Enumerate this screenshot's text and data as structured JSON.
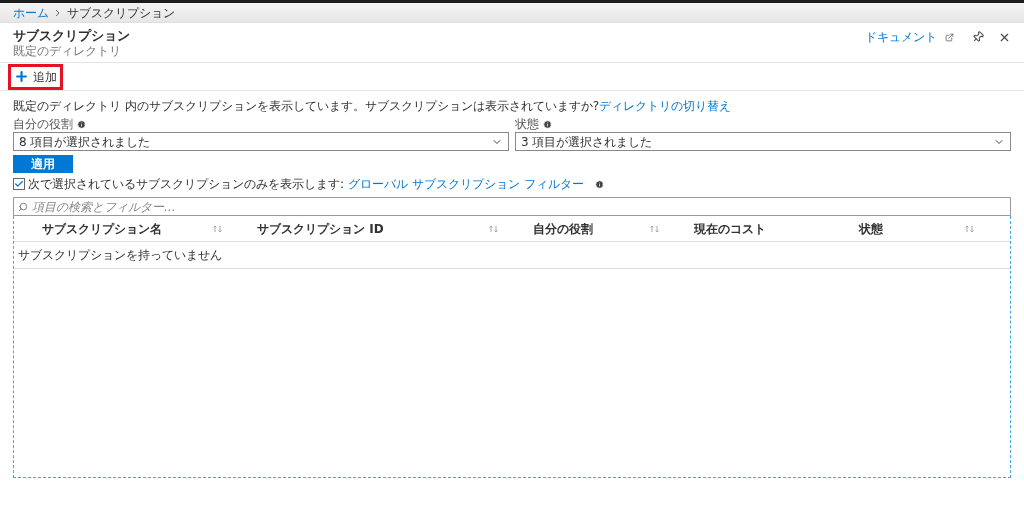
{
  "breadcrumb": [
    {
      "label": "ホーム",
      "link": true
    },
    {
      "label": "サブスクリプション",
      "link": false
    }
  ],
  "header": {
    "title": "サブスクリプション",
    "subtitle": "既定のディレクトリ",
    "docs_link": "ドキュメント"
  },
  "toolbar": {
    "add_button": {
      "label": "追加",
      "highlighted": true
    }
  },
  "notice": {
    "text": "既定のディレクトリ 内のサブスクリプションを表示しています。サブスクリプションは表示されていますか?",
    "link": "ディレクトリの切り替え"
  },
  "filters": [
    {
      "label": "自分の役割",
      "value": "8 項目が選択されました"
    },
    {
      "label": "状態",
      "value": "3 項目が選択されました"
    }
  ],
  "apply_button": "適用",
  "global_filter": {
    "checked": true,
    "text": "次で選択されているサブスクリプションのみを表示します:",
    "link": "グローバル サブスクリプション フィルター"
  },
  "search": {
    "placeholder": "項目の検索とフィルター..."
  },
  "table": {
    "columns": [
      {
        "label": "サブスクリプション名",
        "sortable": true
      },
      {
        "label": "サブスクリプション ID",
        "sortable": true
      },
      {
        "label": "自分の役割",
        "sortable": true
      },
      {
        "label": "現在のコスト",
        "sortable": false
      },
      {
        "label": "状態",
        "sortable": true
      }
    ],
    "empty_message": "サブスクリプションを持っていません"
  }
}
